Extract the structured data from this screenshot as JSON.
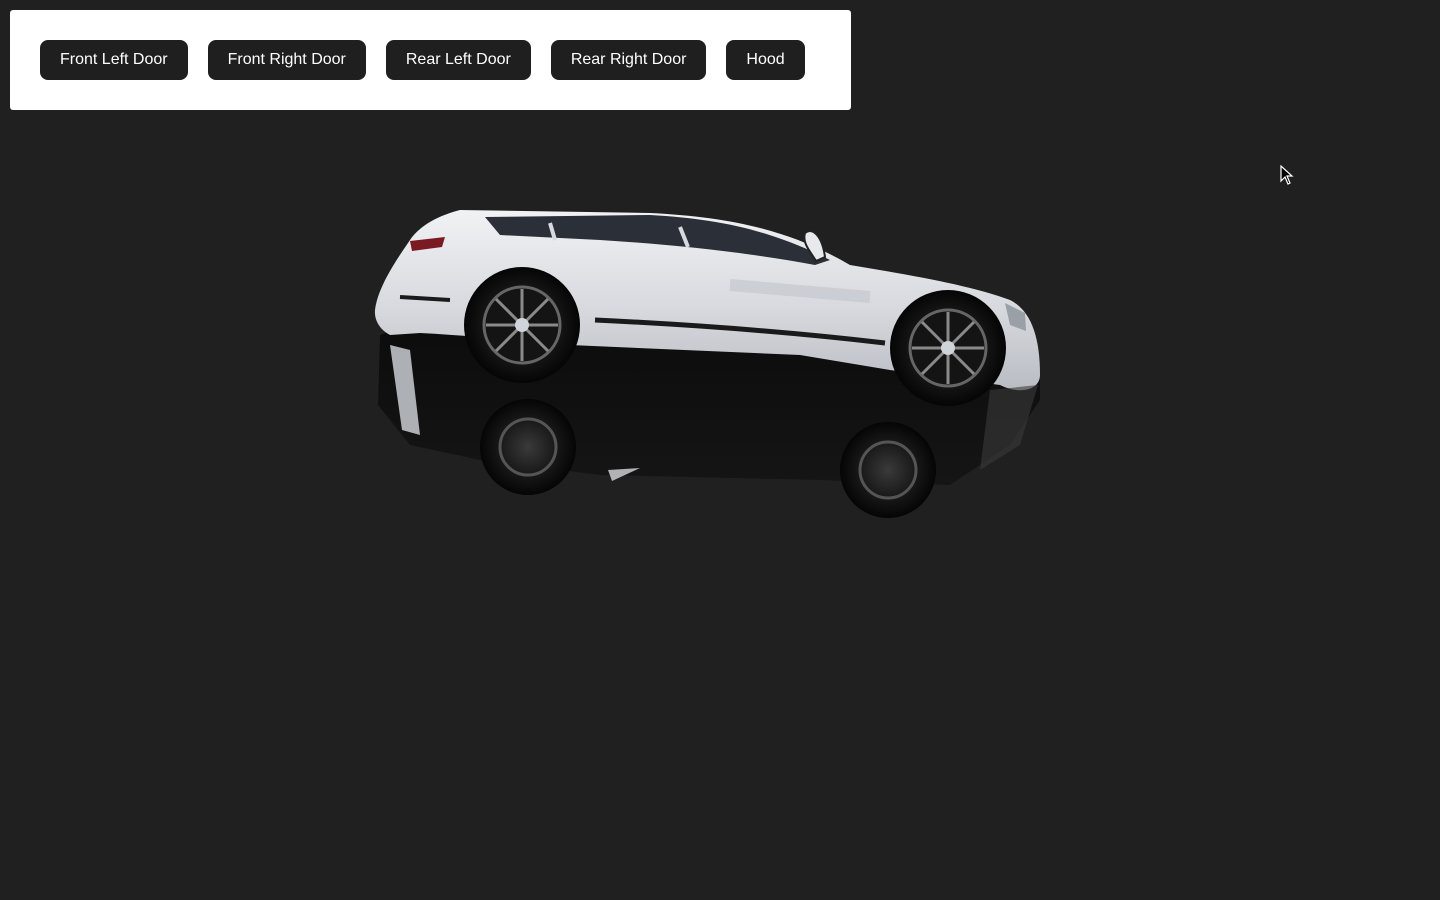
{
  "toolbar": {
    "buttons": [
      {
        "label": "Front Left Door"
      },
      {
        "label": "Front Right Door"
      },
      {
        "label": "Rear Left Door"
      },
      {
        "label": "Rear Right Door"
      },
      {
        "label": "Hood"
      }
    ]
  },
  "viewer": {
    "model": "suv-car-model",
    "background_color": "#202020"
  },
  "colors": {
    "button_bg": "#1f1f1f",
    "button_text": "#ffffff",
    "toolbar_bg": "#ffffff",
    "car_body": "#e6e7ea"
  }
}
